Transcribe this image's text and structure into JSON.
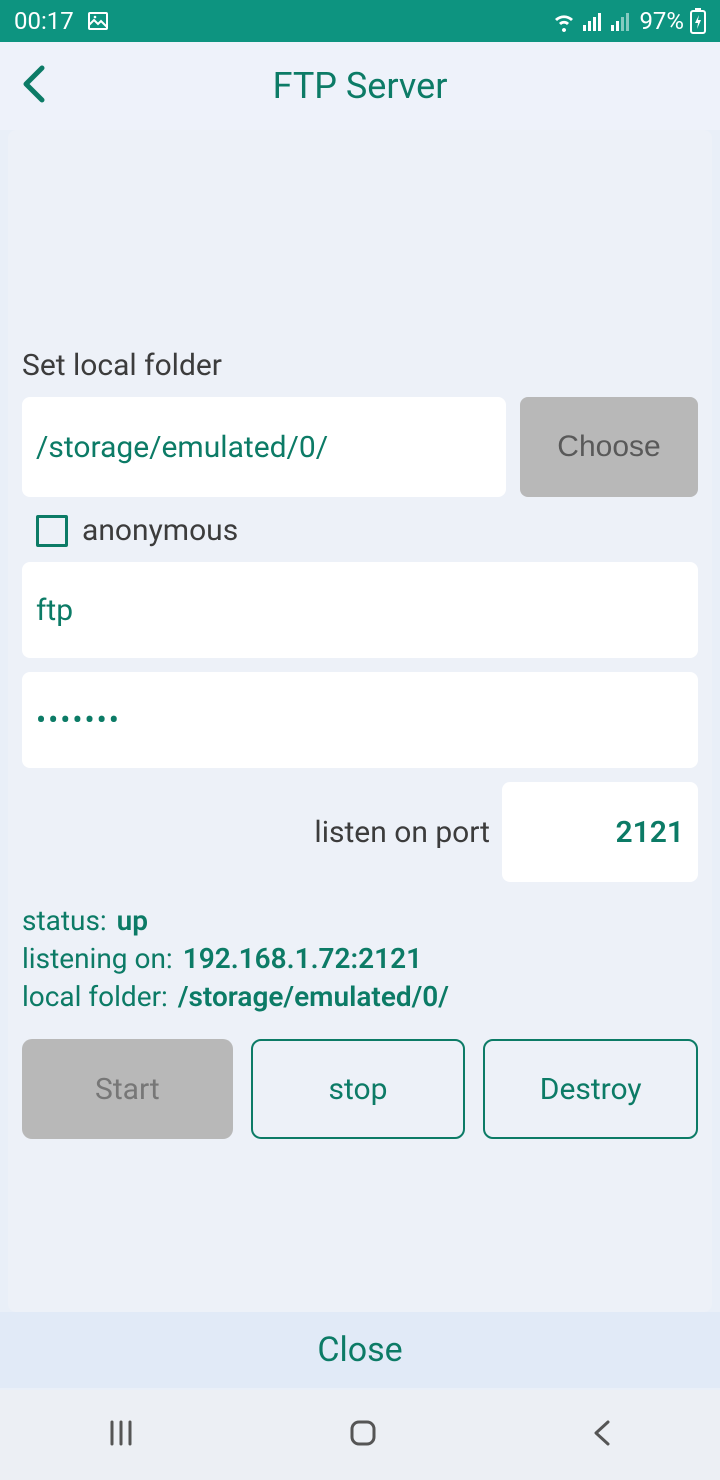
{
  "statusBar": {
    "time": "00:17",
    "battery": "97%"
  },
  "header": {
    "title": "FTP Server"
  },
  "form": {
    "setLocalFolderLabel": "Set local folder",
    "localFolderValue": "/storage/emulated/0/",
    "chooseLabel": "Choose",
    "anonymousLabel": "anonymous",
    "username": "ftp",
    "passwordMasked": "•••••••",
    "listenPortLabel": "listen on port",
    "port": "2121"
  },
  "status": {
    "statusLabel": "status:",
    "statusValue": "up",
    "listeningLabel": "listening on:",
    "listeningValue": "192.168.1.72:2121",
    "localFolderLabel": "local folder:",
    "localFolderValue": "/storage/emulated/0/"
  },
  "buttons": {
    "start": "Start",
    "stop": "stop",
    "destroy": "Destroy",
    "close": "Close"
  }
}
